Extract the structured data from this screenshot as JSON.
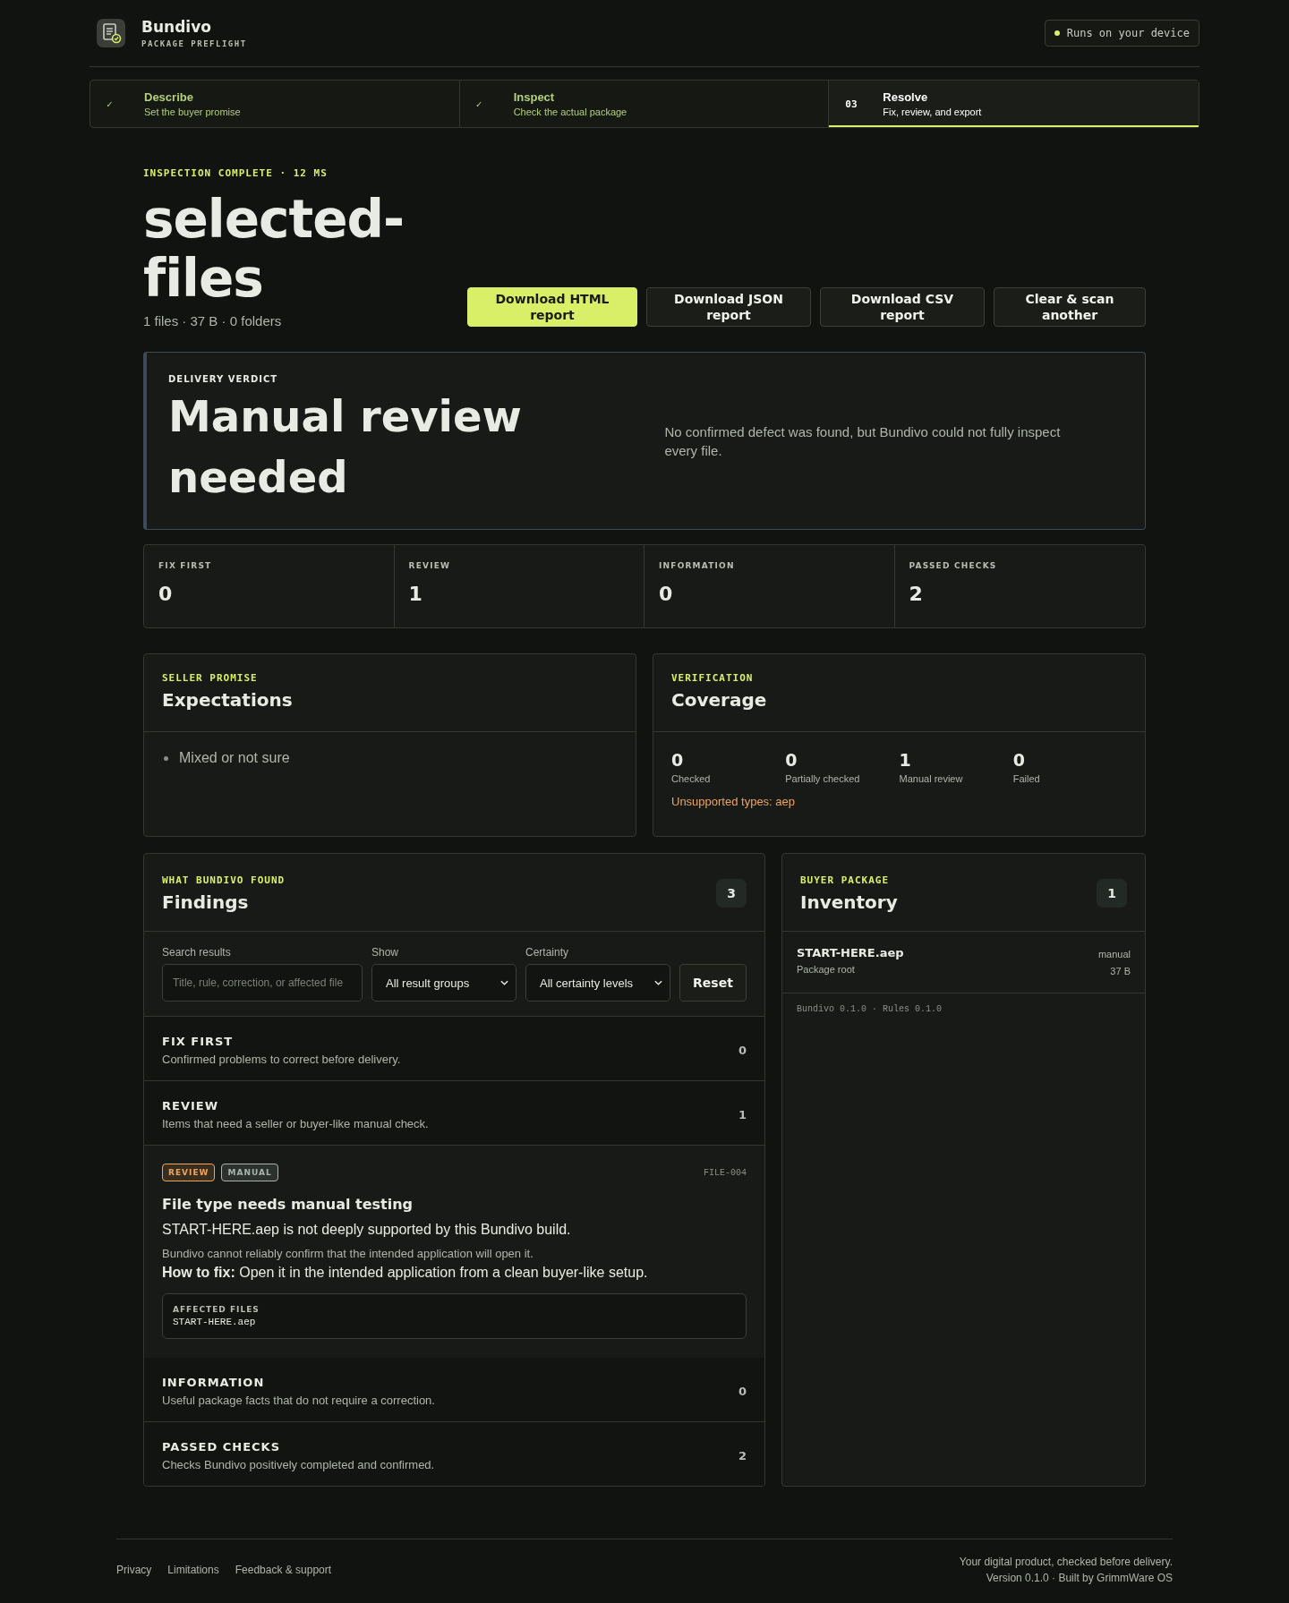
{
  "header": {
    "brand": "Bundivo",
    "tagline": "PACKAGE PREFLIGHT",
    "status": "Runs on your device"
  },
  "steps": [
    {
      "marker": "✓",
      "title": "Describe",
      "subtitle": "Set the buyer promise",
      "selected": false
    },
    {
      "marker": "✓",
      "title": "Inspect",
      "subtitle": "Check the actual package",
      "selected": false
    },
    {
      "marker": "03",
      "title": "Resolve",
      "subtitle": "Fix, review, and export",
      "selected": true
    }
  ],
  "summary": {
    "eyebrow": "INSPECTION COMPLETE · 12 MS",
    "title": "selected-files",
    "meta": "1 files · 37 B · 0 folders",
    "buttons": [
      {
        "label": "Download HTML report",
        "kind": "primary"
      },
      {
        "label": "Download JSON report",
        "kind": "secondary"
      },
      {
        "label": "Download CSV report",
        "kind": "secondary"
      },
      {
        "label": "Clear & scan another",
        "kind": "secondary"
      }
    ]
  },
  "verdict": {
    "eyebrow": "DELIVERY VERDICT",
    "title": "Manual review needed",
    "text": "No confirmed defect was found, but Bundivo could not fully inspect every file."
  },
  "stats": [
    {
      "label": "FIX FIRST",
      "value": "0"
    },
    {
      "label": "REVIEW",
      "value": "1"
    },
    {
      "label": "INFORMATION",
      "value": "0"
    },
    {
      "label": "PASSED CHECKS",
      "value": "2"
    }
  ],
  "expectations": {
    "eyebrow": "SELLER PROMISE",
    "title": "Expectations",
    "items": [
      "Mixed or not sure"
    ]
  },
  "coverage": {
    "eyebrow": "VERIFICATION",
    "title": "Coverage",
    "metrics": [
      {
        "value": "0",
        "label": "Checked"
      },
      {
        "value": "0",
        "label": "Partially checked"
      },
      {
        "value": "1",
        "label": "Manual review"
      },
      {
        "value": "0",
        "label": "Failed"
      }
    ],
    "note": "Unsupported types: aep"
  },
  "findings": {
    "eyebrow": "WHAT BUNDIVO FOUND",
    "title": "Findings",
    "count": "3",
    "filters": {
      "search_label": "Search results",
      "search_placeholder": "Title, rule, correction, or affected file",
      "show_label": "Show",
      "show_value": "All result groups",
      "certainty_label": "Certainty",
      "certainty_value": "All certainty levels",
      "reset": "Reset"
    },
    "rows": [
      {
        "kind": "group",
        "title": "FIX FIRST",
        "description": "Confirmed problems to correct before delivery.",
        "count": "0"
      },
      {
        "kind": "group",
        "title": "REVIEW",
        "description": "Items that need a seller or buyer-like manual check.",
        "count": "1"
      },
      {
        "kind": "finding",
        "tags": [
          {
            "label": "REVIEW",
            "color": "#f0a35a"
          },
          {
            "label": "MANUAL",
            "color": "#a9b3ad"
          }
        ],
        "id": "FILE-004",
        "title": "File type needs manual testing",
        "summary": "START-HERE.aep is not deeply supported by this Bundivo build.",
        "detail": "Bundivo cannot reliably confirm that the intended application will open it.",
        "fix": "**How to fix:** Open it in the intended application from a clean buyer-like setup.",
        "affected_label": "AFFECTED FILES",
        "affected_files": [
          "START-HERE.aep"
        ]
      },
      {
        "kind": "group",
        "title": "INFORMATION",
        "description": "Useful package facts that do not require a correction.",
        "count": "0"
      },
      {
        "kind": "group",
        "title": "PASSED CHECKS",
        "description": "Checks Bundivo positively completed and confirmed.",
        "count": "2"
      }
    ]
  },
  "inventory": {
    "eyebrow": "BUYER PACKAGE",
    "title": "Inventory",
    "count": "1",
    "files": [
      {
        "name": "START-HERE.aep",
        "location": "Package root",
        "status": "manual",
        "size": "37 B"
      }
    ],
    "versions": "Bundivo 0.1.0 · Rules 0.1.0"
  },
  "footer": {
    "links": [
      "Privacy",
      "Limitations",
      "Feedback & support"
    ],
    "tagline": "Your digital product, checked before delivery.",
    "version": "Version 0.1.0 · Built by GrimmWare OS"
  }
}
